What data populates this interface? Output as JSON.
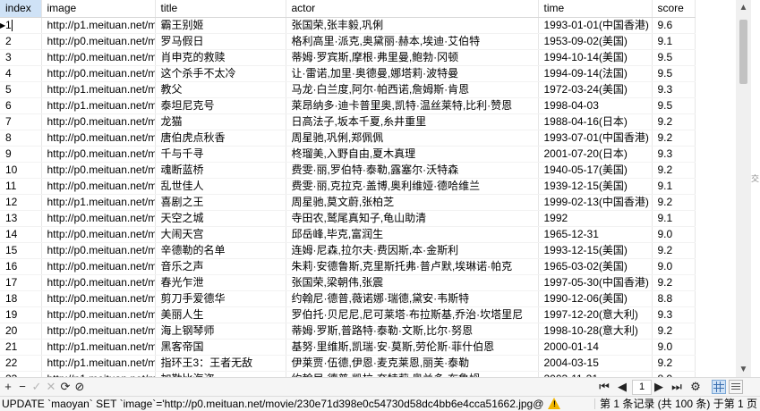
{
  "grid": {
    "columns": [
      "index",
      "image",
      "title",
      "actor",
      "time",
      "score"
    ],
    "sorted_column": "index",
    "rows": [
      [
        "1",
        "http://p1.meituan.net/mo",
        "霸王别姬",
        "张国荣,张丰毅,巩俐",
        "1993-01-01(中国香港)",
        "9.6"
      ],
      [
        "2",
        "http://p0.meituan.net/mo",
        "罗马假日",
        "格利高里·派克,奥黛丽·赫本,埃迪·艾伯特",
        "1953-09-02(美国)",
        "9.1"
      ],
      [
        "3",
        "http://p0.meituan.net/mo",
        "肖申克的救赎",
        "蒂姆·罗宾斯,摩根·弗里曼,鲍勃·冈顿",
        "1994-10-14(美国)",
        "9.5"
      ],
      [
        "4",
        "http://p0.meituan.net/mo",
        "这个杀手不太冷",
        "让·雷诺,加里·奥德曼,娜塔莉·波特曼",
        "1994-09-14(法国)",
        "9.5"
      ],
      [
        "5",
        "http://p1.meituan.net/mo",
        "教父",
        "马龙·白兰度,阿尔·帕西诺,詹姆斯·肯恩",
        "1972-03-24(美国)",
        "9.3"
      ],
      [
        "6",
        "http://p1.meituan.net/mo",
        "泰坦尼克号",
        "莱昂纳多·迪卡普里奥,凯特·温丝莱特,比利·赞恩",
        "1998-04-03",
        "9.5"
      ],
      [
        "7",
        "http://p0.meituan.net/mo",
        "龙猫",
        "日高法子,坂本千夏,糸井重里",
        "1988-04-16(日本)",
        "9.2"
      ],
      [
        "8",
        "http://p0.meituan.net/mo",
        "唐伯虎点秋香",
        "周星驰,巩俐,郑佩佩",
        "1993-07-01(中国香港)",
        "9.2"
      ],
      [
        "9",
        "http://p0.meituan.net/mo",
        "千与千寻",
        "柊瑠美,入野自由,夏木真理",
        "2001-07-20(日本)",
        "9.3"
      ],
      [
        "10",
        "http://p0.meituan.net/mo",
        "魂断蓝桥",
        "费雯·丽,罗伯特·泰勒,露塞尔·沃特森",
        "1940-05-17(美国)",
        "9.2"
      ],
      [
        "11",
        "http://p0.meituan.net/mo",
        "乱世佳人",
        "费雯·丽,克拉克·盖博,奥利维娅·德哈维兰",
        "1939-12-15(美国)",
        "9.1"
      ],
      [
        "12",
        "http://p1.meituan.net/mo",
        "喜剧之王",
        "周星驰,莫文蔚,张柏芝",
        "1999-02-13(中国香港)",
        "9.2"
      ],
      [
        "13",
        "http://p0.meituan.net/mo",
        "天空之城",
        "寺田农,鹫尾真知子,龟山助清",
        "1992",
        "9.1"
      ],
      [
        "14",
        "http://p0.meituan.net/mo",
        "大闹天宫",
        "邱岳峰,毕克,富润生",
        "1965-12-31",
        "9.0"
      ],
      [
        "15",
        "http://p0.meituan.net/mo",
        "辛德勒的名单",
        "连姆·尼森,拉尔夫·费因斯,本·金斯利",
        "1993-12-15(美国)",
        "9.2"
      ],
      [
        "16",
        "http://p0.meituan.net/mo",
        "音乐之声",
        "朱莉·安德鲁斯,克里斯托弗·普卢默,埃琳诺·帕克",
        "1965-03-02(美国)",
        "9.0"
      ],
      [
        "17",
        "http://p0.meituan.net/mo",
        "春光乍泄",
        "张国荣,梁朝伟,张震",
        "1997-05-30(中国香港)",
        "9.2"
      ],
      [
        "18",
        "http://p0.meituan.net/mo",
        "剪刀手爱德华",
        "约翰尼·德普,薇诺娜·瑞德,黛安·韦斯特",
        "1990-12-06(美国)",
        "8.8"
      ],
      [
        "19",
        "http://p0.meituan.net/mo",
        "美丽人生",
        "罗伯托·贝尼尼,尼可莱塔·布拉斯基,乔治·坎塔里尼",
        "1997-12-20(意大利)",
        "9.3"
      ],
      [
        "20",
        "http://p0.meituan.net/mo",
        "海上钢琴师",
        "蒂姆·罗斯,普路特·泰勒·文斯,比尔·努恩",
        "1998-10-28(意大利)",
        "9.2"
      ],
      [
        "21",
        "http://p1.meituan.net/mo",
        "黑客帝国",
        "基努·里维斯,凯瑞·安·莫斯,劳伦斯·菲什伯恩",
        "2000-01-14",
        "9.0"
      ],
      [
        "22",
        "http://p1.meituan.net/mo",
        "指环王3：王者无敌",
        "伊莱贾·伍德,伊恩·麦克莱恩,丽芙·泰勒",
        "2004-03-15",
        "9.2"
      ],
      [
        "23",
        "http://p1.meituan.net/mo",
        "加勒比海盗",
        "约翰尼·德普,凯拉·奈特莉,奥兰多·布鲁姆",
        "2003-11-21",
        "8.9"
      ]
    ]
  },
  "toolbar": {
    "add_icon": "+",
    "remove_icon": "−",
    "apply_icon": "✓",
    "discard_icon": "✕",
    "refresh_icon": "⟳",
    "stop_icon": "⊘",
    "first_icon": "⏮",
    "prev_icon": "◀",
    "page": "1",
    "next_icon": "▶",
    "last_icon": "⏭",
    "settings_icon": "⚙"
  },
  "status": {
    "sql": "UPDATE `maoyan` SET `image`='http://p0.meituan.net/movie/230e71d398e0c54730d58dc4bb6e4cca51662.jpg@160w_2",
    "info": "第 1 条记录 (共 100 条) 于第 1 页",
    "warning_icon": "!"
  },
  "right_edge_glyph": "交"
}
